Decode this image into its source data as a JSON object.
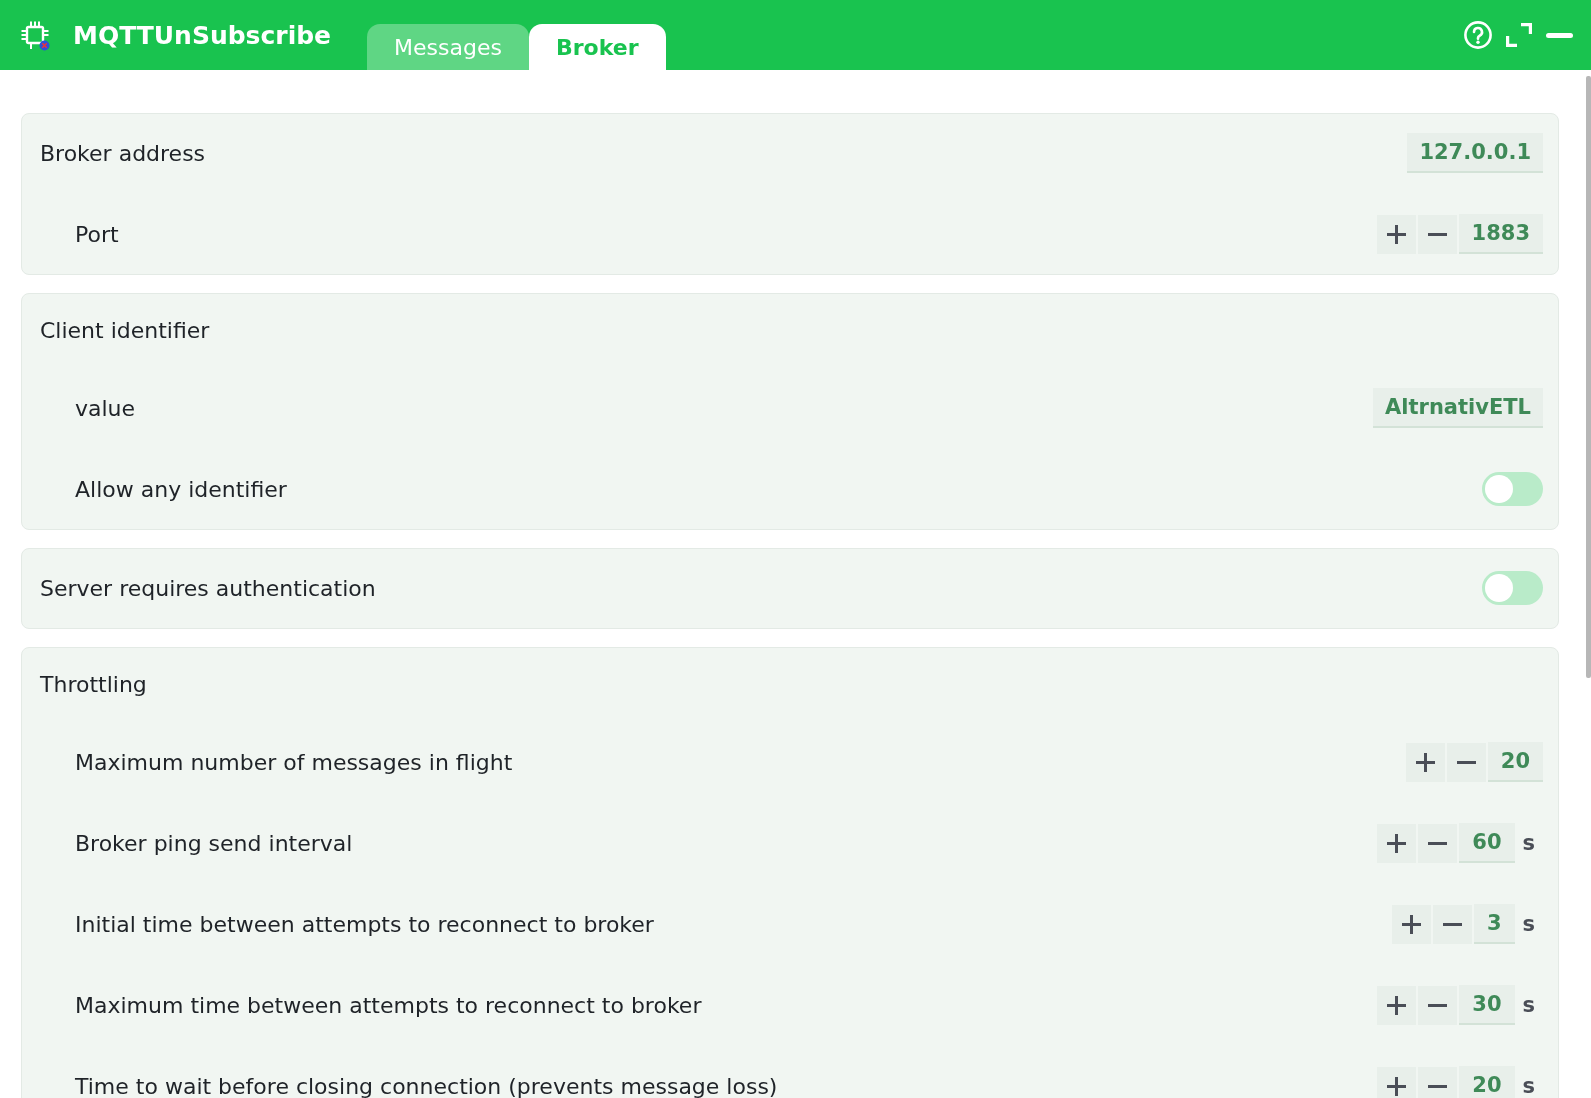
{
  "header": {
    "title": "MQTTUnSubscribe"
  },
  "tabs": [
    {
      "label": "Messages",
      "selected": false
    },
    {
      "label": "Broker",
      "selected": true
    }
  ],
  "groups": [
    {
      "label": "Broker address",
      "kind": "text",
      "value": "127.0.0.1",
      "children": [
        {
          "label": "Port",
          "kind": "number",
          "value": "1883"
        }
      ]
    },
    {
      "label": "Client identifier",
      "kind": "heading",
      "children": [
        {
          "label": "value",
          "kind": "text",
          "value": "AltrnativETL"
        },
        {
          "label": "Allow any identifier",
          "kind": "toggle",
          "on": false
        }
      ]
    },
    {
      "label": "Server requires authentication",
      "kind": "toggle",
      "on": false
    },
    {
      "label": "Throttling",
      "kind": "heading",
      "children": [
        {
          "label": "Maximum number of messages in flight",
          "kind": "number",
          "value": "20"
        },
        {
          "label": "Broker ping send interval",
          "kind": "number",
          "value": "60",
          "unit": "s"
        },
        {
          "label": "Initial time between attempts to reconnect to broker",
          "kind": "number",
          "value": "3",
          "unit": "s"
        },
        {
          "label": "Maximum time between attempts to reconnect to broker",
          "kind": "number",
          "value": "30",
          "unit": "s"
        },
        {
          "label": "Time to wait before closing connection (prevents message loss)",
          "kind": "number",
          "value": "20",
          "unit": "s"
        }
      ]
    }
  ]
}
